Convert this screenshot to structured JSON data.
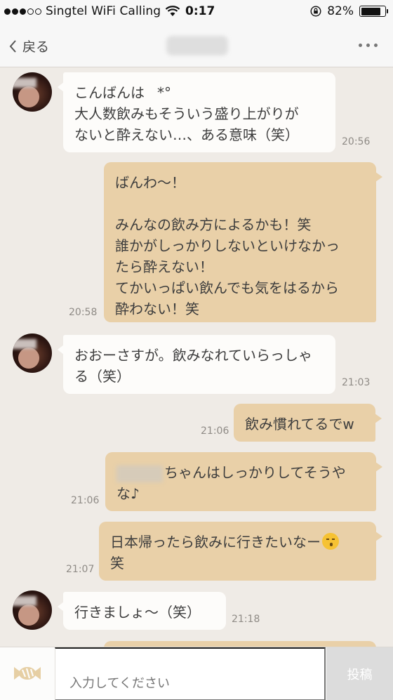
{
  "status_bar": {
    "carrier": "Singtel WiFi Calling",
    "time": "0:17",
    "battery": "82%",
    "battery_level": 0.82
  },
  "nav": {
    "back_label": "戻る"
  },
  "messages": [
    {
      "side": "in",
      "lines": [
        "こんばんは",
        "大人数飲みもそういう盛り上がりが",
        "ないと酔えない…、ある意味（笑）"
      ],
      "first_suffix": "*°",
      "time": "20:56"
    },
    {
      "side": "out",
      "lines": [
        "ばんわ〜！",
        "",
        "みんなの飲み方によるかも！笑",
        "誰かがしっかりしないといけなかっ",
        "たら酔えない！",
        "てかいっぱい飲んでも気をはるから",
        "酔わない！笑"
      ],
      "time": "20:58"
    },
    {
      "side": "in",
      "lines": [
        "おおーさすが。飲みなれていらっしゃ",
        "る（笑）"
      ],
      "time": "21:03"
    },
    {
      "side": "out",
      "lines": [
        "飲み慣れてるでw"
      ],
      "time": "21:06"
    },
    {
      "side": "out",
      "lines": [
        "ちゃんはしっかりしてそうや",
        "な♪"
      ],
      "time": "21:06"
    },
    {
      "side": "out",
      "lines": [
        "日本帰ったら飲みに行きたいなー",
        "笑"
      ],
      "time": "21:07"
    },
    {
      "side": "in",
      "lines": [
        "行きましょ〜（笑）"
      ],
      "time": "21:18"
    }
  ],
  "input": {
    "placeholder": "入力してください",
    "post_label": "投稿"
  },
  "icons": {
    "back": "chevron-left-icon",
    "more": "more-dots-icon",
    "wifi": "wifi-icon",
    "lock": "rotation-lock-icon",
    "candy": "candy-icon",
    "moon": "crescent-moon-emoji",
    "kiss": "kissing-face-emoji"
  },
  "colors": {
    "background": "#efebe6",
    "incoming_bubble": "#fdfcfa",
    "outgoing_bubble": "#e9d0a8",
    "post_button": "#dcdcdc"
  }
}
